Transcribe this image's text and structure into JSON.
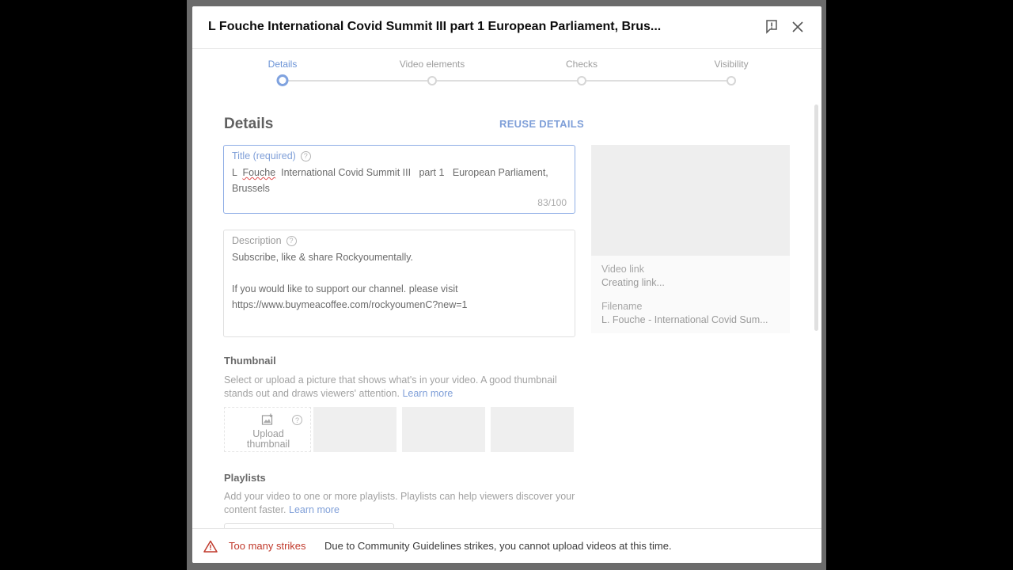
{
  "dialog": {
    "title": "L Fouche International Covid Summit III part 1 European Parliament, Brus...",
    "feedback_icon": "report-flag-icon",
    "close_icon": "close-icon"
  },
  "stepper": {
    "steps": [
      {
        "label": "Details",
        "active": true
      },
      {
        "label": "Video elements",
        "active": false
      },
      {
        "label": "Checks",
        "active": false
      },
      {
        "label": "Visibility",
        "active": false
      }
    ]
  },
  "details": {
    "heading": "Details",
    "reuse_label": "REUSE DETAILS",
    "title_field": {
      "label": "Title (required)",
      "value_word1": "L",
      "value_word2": "Fouche",
      "value_rest": "  International Covid Summit III   part 1   European Parliament, Brussels",
      "counter": "83/100"
    },
    "description_field": {
      "label": "Description",
      "value": "Subscribe, like & share Rockyoumentally.\n\nIf you would like to support our channel. please visit\nhttps://www.buymeacoffee.com/rockyoumenC?new=1"
    }
  },
  "preview": {
    "video_link_label": "Video link",
    "video_link_value": "Creating link...",
    "filename_label": "Filename",
    "filename_value": "L. Fouche - International Covid Sum..."
  },
  "thumbnail": {
    "heading": "Thumbnail",
    "description": "Select or upload a picture that shows what's in your video. A good thumbnail stands out and draws viewers' attention.",
    "learn_more": "Learn more",
    "upload_label_1": "Upload",
    "upload_label_2": "thumbnail"
  },
  "playlists": {
    "heading": "Playlists",
    "description": "Add your video to one or more playlists. Playlists can help viewers discover your content faster.",
    "learn_more": "Learn more"
  },
  "footer": {
    "strike_title": "Too many strikes",
    "strike_message": "Due to Community Guidelines strikes, you cannot upload videos at this time."
  },
  "colors": {
    "accent": "#7f9fd8",
    "warning": "#c0392b"
  }
}
